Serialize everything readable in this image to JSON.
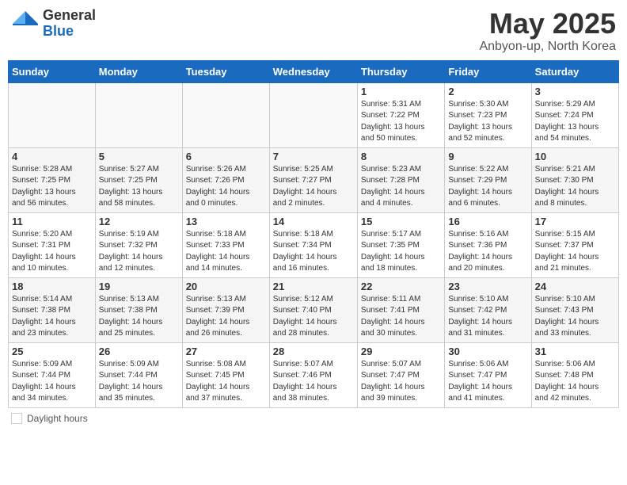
{
  "header": {
    "logo_general": "General",
    "logo_blue": "Blue",
    "month_title": "May 2025",
    "location": "Anbyon-up, North Korea"
  },
  "weekdays": [
    "Sunday",
    "Monday",
    "Tuesday",
    "Wednesday",
    "Thursday",
    "Friday",
    "Saturday"
  ],
  "weeks": [
    [
      {
        "day": "",
        "info": ""
      },
      {
        "day": "",
        "info": ""
      },
      {
        "day": "",
        "info": ""
      },
      {
        "day": "",
        "info": ""
      },
      {
        "day": "1",
        "info": "Sunrise: 5:31 AM\nSunset: 7:22 PM\nDaylight: 13 hours\nand 50 minutes."
      },
      {
        "day": "2",
        "info": "Sunrise: 5:30 AM\nSunset: 7:23 PM\nDaylight: 13 hours\nand 52 minutes."
      },
      {
        "day": "3",
        "info": "Sunrise: 5:29 AM\nSunset: 7:24 PM\nDaylight: 13 hours\nand 54 minutes."
      }
    ],
    [
      {
        "day": "4",
        "info": "Sunrise: 5:28 AM\nSunset: 7:25 PM\nDaylight: 13 hours\nand 56 minutes."
      },
      {
        "day": "5",
        "info": "Sunrise: 5:27 AM\nSunset: 7:25 PM\nDaylight: 13 hours\nand 58 minutes."
      },
      {
        "day": "6",
        "info": "Sunrise: 5:26 AM\nSunset: 7:26 PM\nDaylight: 14 hours\nand 0 minutes."
      },
      {
        "day": "7",
        "info": "Sunrise: 5:25 AM\nSunset: 7:27 PM\nDaylight: 14 hours\nand 2 minutes."
      },
      {
        "day": "8",
        "info": "Sunrise: 5:23 AM\nSunset: 7:28 PM\nDaylight: 14 hours\nand 4 minutes."
      },
      {
        "day": "9",
        "info": "Sunrise: 5:22 AM\nSunset: 7:29 PM\nDaylight: 14 hours\nand 6 minutes."
      },
      {
        "day": "10",
        "info": "Sunrise: 5:21 AM\nSunset: 7:30 PM\nDaylight: 14 hours\nand 8 minutes."
      }
    ],
    [
      {
        "day": "11",
        "info": "Sunrise: 5:20 AM\nSunset: 7:31 PM\nDaylight: 14 hours\nand 10 minutes."
      },
      {
        "day": "12",
        "info": "Sunrise: 5:19 AM\nSunset: 7:32 PM\nDaylight: 14 hours\nand 12 minutes."
      },
      {
        "day": "13",
        "info": "Sunrise: 5:18 AM\nSunset: 7:33 PM\nDaylight: 14 hours\nand 14 minutes."
      },
      {
        "day": "14",
        "info": "Sunrise: 5:18 AM\nSunset: 7:34 PM\nDaylight: 14 hours\nand 16 minutes."
      },
      {
        "day": "15",
        "info": "Sunrise: 5:17 AM\nSunset: 7:35 PM\nDaylight: 14 hours\nand 18 minutes."
      },
      {
        "day": "16",
        "info": "Sunrise: 5:16 AM\nSunset: 7:36 PM\nDaylight: 14 hours\nand 20 minutes."
      },
      {
        "day": "17",
        "info": "Sunrise: 5:15 AM\nSunset: 7:37 PM\nDaylight: 14 hours\nand 21 minutes."
      }
    ],
    [
      {
        "day": "18",
        "info": "Sunrise: 5:14 AM\nSunset: 7:38 PM\nDaylight: 14 hours\nand 23 minutes."
      },
      {
        "day": "19",
        "info": "Sunrise: 5:13 AM\nSunset: 7:38 PM\nDaylight: 14 hours\nand 25 minutes."
      },
      {
        "day": "20",
        "info": "Sunrise: 5:13 AM\nSunset: 7:39 PM\nDaylight: 14 hours\nand 26 minutes."
      },
      {
        "day": "21",
        "info": "Sunrise: 5:12 AM\nSunset: 7:40 PM\nDaylight: 14 hours\nand 28 minutes."
      },
      {
        "day": "22",
        "info": "Sunrise: 5:11 AM\nSunset: 7:41 PM\nDaylight: 14 hours\nand 30 minutes."
      },
      {
        "day": "23",
        "info": "Sunrise: 5:10 AM\nSunset: 7:42 PM\nDaylight: 14 hours\nand 31 minutes."
      },
      {
        "day": "24",
        "info": "Sunrise: 5:10 AM\nSunset: 7:43 PM\nDaylight: 14 hours\nand 33 minutes."
      }
    ],
    [
      {
        "day": "25",
        "info": "Sunrise: 5:09 AM\nSunset: 7:44 PM\nDaylight: 14 hours\nand 34 minutes."
      },
      {
        "day": "26",
        "info": "Sunrise: 5:09 AM\nSunset: 7:44 PM\nDaylight: 14 hours\nand 35 minutes."
      },
      {
        "day": "27",
        "info": "Sunrise: 5:08 AM\nSunset: 7:45 PM\nDaylight: 14 hours\nand 37 minutes."
      },
      {
        "day": "28",
        "info": "Sunrise: 5:07 AM\nSunset: 7:46 PM\nDaylight: 14 hours\nand 38 minutes."
      },
      {
        "day": "29",
        "info": "Sunrise: 5:07 AM\nSunset: 7:47 PM\nDaylight: 14 hours\nand 39 minutes."
      },
      {
        "day": "30",
        "info": "Sunrise: 5:06 AM\nSunset: 7:47 PM\nDaylight: 14 hours\nand 41 minutes."
      },
      {
        "day": "31",
        "info": "Sunrise: 5:06 AM\nSunset: 7:48 PM\nDaylight: 14 hours\nand 42 minutes."
      }
    ]
  ],
  "legend": {
    "label": "Daylight hours"
  }
}
